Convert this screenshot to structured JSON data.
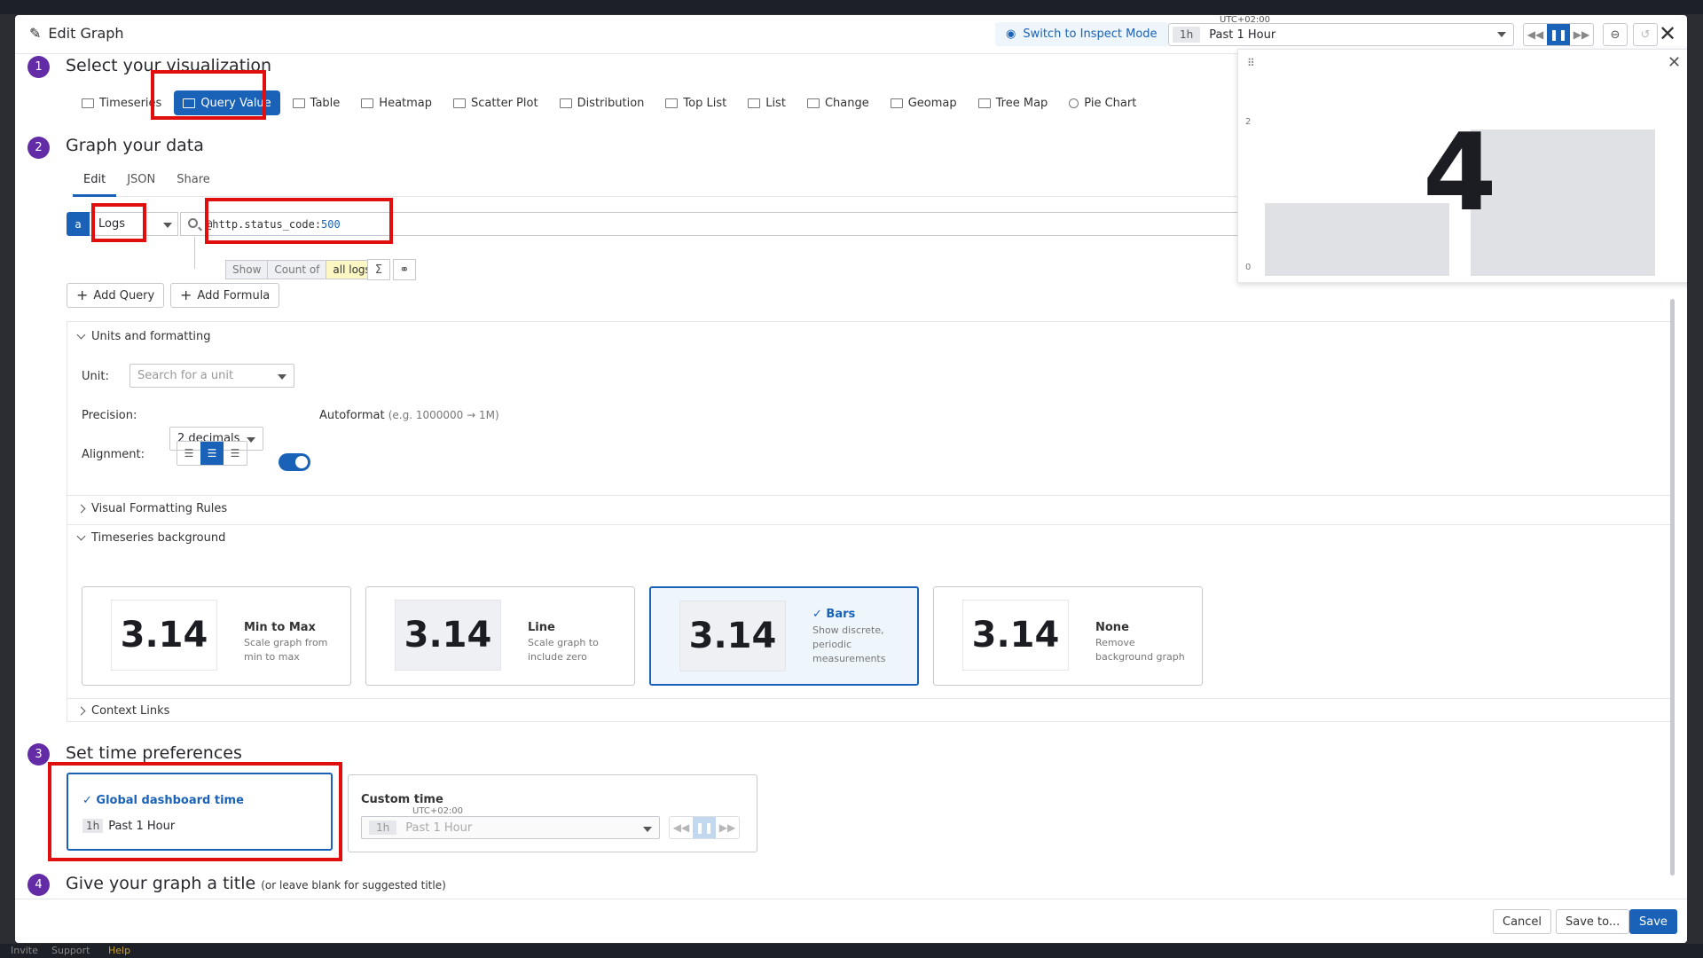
{
  "window": {
    "title": "Edit Graph",
    "inspect_label": "Switch to Inspect Mode",
    "timezone": "UTC+02:00",
    "time_pill": "1h",
    "time_label": "Past 1 Hour"
  },
  "steps": {
    "s1": {
      "num": "1",
      "title": "Select your visualization"
    },
    "s2": {
      "num": "2",
      "title": "Graph your data"
    },
    "s3": {
      "num": "3",
      "title": "Set time preferences"
    },
    "s4": {
      "num": "4",
      "title": "Give your graph a title",
      "hint": "(or leave blank for suggested title)"
    }
  },
  "viz_types": [
    "Timeseries",
    "Query Value",
    "Table",
    "Heatmap",
    "Scatter Plot",
    "Distribution",
    "Top List",
    "List",
    "Change",
    "Geomap",
    "Tree Map",
    "Pie Chart"
  ],
  "viz_selected": "Query Value",
  "tabs": [
    "Edit",
    "JSON",
    "Share"
  ],
  "query": {
    "letter": "a",
    "source": "Logs",
    "search_key": "@http.status_code:",
    "search_val": "500",
    "show": "Show",
    "count_of": "Count of",
    "target": "all logs",
    "sigma": "Σ"
  },
  "buttons": {
    "add_query": "Add Query",
    "add_formula": "Add Formula",
    "cancel": "Cancel",
    "save_to": "Save to...",
    "save": "Save"
  },
  "units": {
    "section_title": "Units and formatting",
    "unit_label": "Unit:",
    "unit_placeholder": "Search for a unit",
    "precision_label": "Precision:",
    "precision_value": "2 decimals",
    "autoformat_label": "Autoformat",
    "autoformat_hint": "(e.g. 1000000 → 1M)",
    "alignment_label": "Alignment:"
  },
  "sections": {
    "visual_rules": "Visual Formatting Rules",
    "timeseries_bg": "Timeseries background",
    "context_links": "Context Links"
  },
  "bg_options": [
    {
      "value": "3.14",
      "name": "Min to Max",
      "desc": "Scale graph from min to max"
    },
    {
      "value": "3.14",
      "name": "Line",
      "desc": "Scale graph to include zero"
    },
    {
      "value": "3.14",
      "name": "Bars",
      "desc": "Show discrete, periodic measurements"
    },
    {
      "value": "3.14",
      "name": "None",
      "desc": "Remove background graph"
    }
  ],
  "time_prefs": {
    "global_label": "Global dashboard time",
    "global_pill": "1h",
    "global_value": "Past 1 Hour",
    "custom_label": "Custom time",
    "custom_tz": "UTC+02:00",
    "custom_pill": "1h",
    "custom_value": "Past 1 Hour"
  },
  "preview": {
    "value": "4",
    "y_top": "2",
    "y_bottom": "0"
  },
  "background_bar": {
    "invite": "Invite",
    "support": "Support",
    "help": "Help"
  }
}
